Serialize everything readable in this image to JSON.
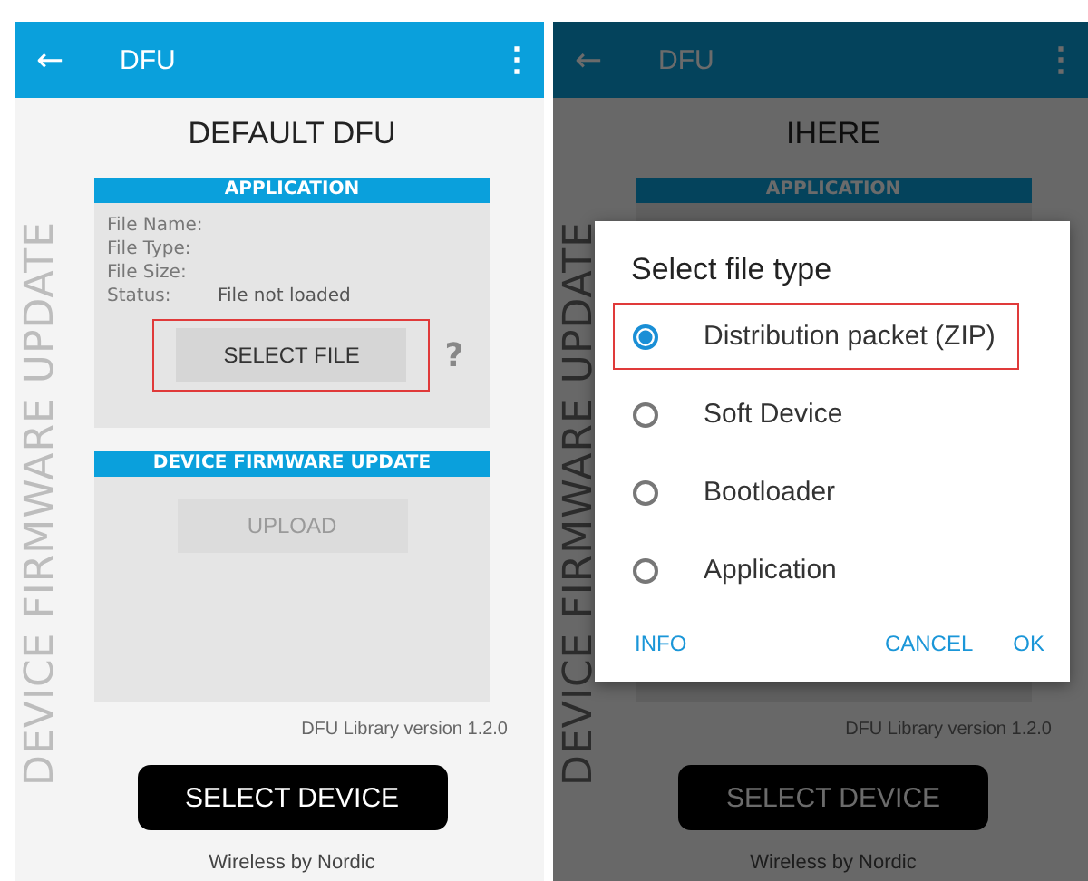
{
  "screens": [
    {
      "app_bar": {
        "back": "←",
        "title": "DFU",
        "menu": "⋮"
      },
      "heading": "DEFAULT DFU",
      "side_label": "DEVICE FIRMWARE UPDATE",
      "application_panel": {
        "header": "APPLICATION",
        "fields": [
          {
            "label": "File Name:"
          },
          {
            "label": "File Type:"
          },
          {
            "label": "File Size:"
          },
          {
            "label": "Status:",
            "value": "File not loaded"
          }
        ],
        "select_file": {
          "label": "SELECT FILE",
          "highlighted": true
        },
        "help": "?"
      },
      "dfu_panel": {
        "header": "DEVICE FIRMWARE UPDATE",
        "upload": {
          "label": "UPLOAD",
          "disabled": true
        }
      },
      "version": "DFU Library version 1.2.0",
      "select_device": "SELECT DEVICE",
      "footer": "Wireless by Nordic"
    },
    {
      "app_bar": {
        "back": "←",
        "title": "DFU",
        "menu": "⋮"
      },
      "heading": "IHERE",
      "side_label": "DEVICE FIRMWARE UPDATE",
      "application_panel": {
        "header": "APPLICATION"
      },
      "version": "DFU Library version 1.2.0",
      "select_device": "SELECT DEVICE",
      "footer": "Wireless by Nordic",
      "dialog": {
        "title": "Select file type",
        "options": [
          {
            "label": "Distribution packet (ZIP)",
            "selected": true,
            "highlighted": true
          },
          {
            "label": "Soft Device",
            "selected": false,
            "highlighted": false
          },
          {
            "label": "Bootloader",
            "selected": false,
            "highlighted": false
          },
          {
            "label": "Application",
            "selected": false,
            "highlighted": false
          }
        ],
        "buttons": [
          {
            "label": "INFO",
            "kind": "left"
          },
          {
            "label": "CANCEL",
            "kind": "right"
          },
          {
            "label": "OK",
            "kind": "right"
          }
        ]
      }
    }
  ]
}
